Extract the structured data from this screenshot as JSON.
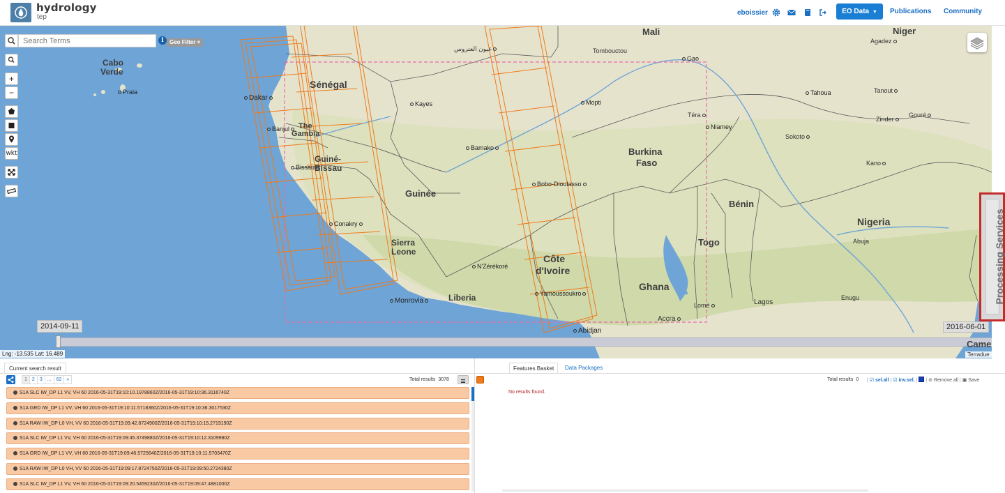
{
  "header": {
    "brand_title": "hydrology",
    "brand_sub": "tep",
    "username": "eboissier",
    "eo_data_label": "EO Data",
    "publications_label": "Publications",
    "community_label": "Community",
    "accent_color": "#1a7fd4"
  },
  "map": {
    "search_placeholder": "Search Terms",
    "info_label": "i",
    "geo_filter_label": "Geo Filter ×",
    "wkt_label": "wkt",
    "zoom_in": "+",
    "zoom_out": "−",
    "start_date": "2014-09-11",
    "end_date": "2016-06-01",
    "coordinates": "Lng: -13.535 Lat: 16.489",
    "attribution": "Terradue",
    "footprint_color": "#f07a1a",
    "aoi_color": "#e86aa8",
    "countries": [
      {
        "id": "mali",
        "text": "Mali"
      },
      {
        "id": "niger",
        "text": "Niger"
      },
      {
        "id": "cabo1",
        "text": "Cabo"
      },
      {
        "id": "cabo2",
        "text": "Verde"
      },
      {
        "id": "senegal",
        "text": "Sénégal"
      },
      {
        "id": "gambia1",
        "text": "The"
      },
      {
        "id": "gambia2",
        "text": "Gambia"
      },
      {
        "id": "guinebissau1",
        "text": "Guiné-"
      },
      {
        "id": "guinebissau2",
        "text": "Bissau"
      },
      {
        "id": "guinee",
        "text": "Guinée"
      },
      {
        "id": "sierra1",
        "text": "Sierra"
      },
      {
        "id": "sierra2",
        "text": "Leone"
      },
      {
        "id": "liberia",
        "text": "Liberia"
      },
      {
        "id": "burkina1",
        "text": "Burkina"
      },
      {
        "id": "burkina2",
        "text": "Faso"
      },
      {
        "id": "cote1",
        "text": "Côte"
      },
      {
        "id": "cote2",
        "text": "d'Ivoire"
      },
      {
        "id": "ghana",
        "text": "Ghana"
      },
      {
        "id": "togo",
        "text": "Togo"
      },
      {
        "id": "benin",
        "text": "Bénin"
      },
      {
        "id": "nigeria",
        "text": "Nigeria"
      },
      {
        "id": "cameroon",
        "text": "Camerou"
      }
    ],
    "cities": {
      "praia": "Praia",
      "dakar": "Dakar",
      "banjul": "Banjul",
      "bissau": "Bissau",
      "kayes": "Kayes",
      "conakry": "Conakry",
      "monrovia": "Monrovia",
      "bamako": "Bamako",
      "bobo": "Bobo-Dioulasso",
      "nzerekore": "N'Zérékoré",
      "yamoussoukro": "Yamoussoukro",
      "abidjan": "Abidjan",
      "tombouctou": "Tombouctou",
      "gao": "Gao",
      "mopti": "Mopti",
      "tera": "Téra",
      "niamey": "Niamey",
      "agadez": "Agadez",
      "tahoua": "Tahoua",
      "tanout": "Tanout",
      "zinder": "Zinder",
      "goure": "Gouré",
      "sokoto": "Sokoto",
      "kano": "Kano",
      "abuja": "Abuja",
      "lome": "Lomé",
      "accra": "Accra",
      "lagos": "Lagos",
      "enugu": "Enugu",
      "ayoun": "عيون العتروس"
    }
  },
  "processing_services": {
    "label": "Processing Services"
  },
  "search_panel": {
    "tab_label": "Current search result",
    "pages": [
      "1",
      "2",
      "3",
      "...",
      "62",
      "»"
    ],
    "total_label": "Total results",
    "total_value": "3078",
    "results": [
      "S1A SLC IW_DP L1 VV, VH 60 2016-05-31T19:10:10.1978860Z/2016-05-31T19:10:36.3116740Z",
      "S1A GRD IW_DP L1 VV, VH 60 2016-05-31T19:10:11.5718360Z/2016-05-31T19:10:36.3017530Z",
      "S1A RAW IW_DP L0 VH, VV 60 2016-05-31T19:09:42.8724900Z/2016-05-31T19:10:15.2719190Z",
      "S1A SLC IW_DP L1 VV, VH 60 2016-05-31T19:09:45.3749880Z/2016-05-31T19:10:12.3109980Z",
      "S1A GRD IW_DP L1 VV, VH 60 2016-05-31T19:09:46.5725640Z/2016-05-31T19:10:11.5703470Z",
      "S1A RAW IW_DP L0 VH, VV 60 2016-05-31T19:09:17.8724750Z/2016-05-31T19:09:50.2724380Z",
      "S1A SLC IW_DP L1 VV, VH 60 2016-05-31T19:09:20.5459230Z/2016-05-31T19:09:47.4881000Z"
    ]
  },
  "basket_panel": {
    "tab_basket": "Features Basket",
    "tab_packages": "Data Packages",
    "total_label": "Total results",
    "total_value": "0",
    "sel_all": "sel.all",
    "inv_sel": "inv.sel.",
    "remove_all": "Remove all",
    "save": "Save",
    "no_results": "No results found."
  }
}
